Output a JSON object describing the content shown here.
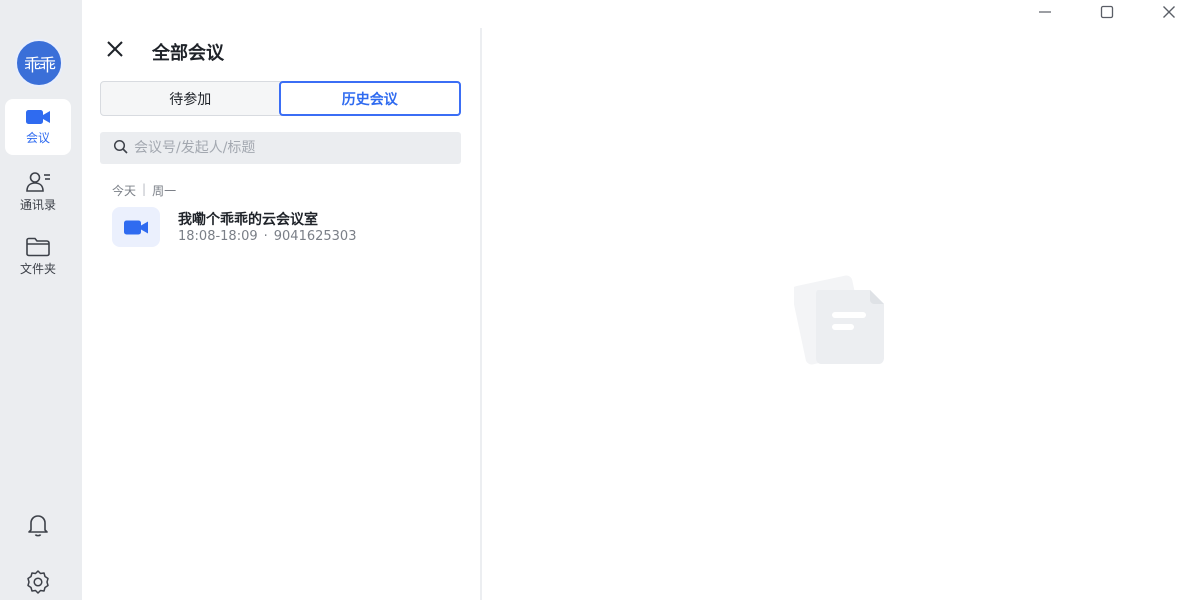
{
  "rail": {
    "avatar_text": "乖乖",
    "items": [
      {
        "label": "会议",
        "icon": "video-camera-icon",
        "active": true
      },
      {
        "label": "通讯录",
        "icon": "contacts-icon",
        "active": false
      },
      {
        "label": "文件夹",
        "icon": "folder-icon",
        "active": false
      }
    ],
    "bottom_icons": [
      "bell-icon",
      "gear-icon"
    ]
  },
  "panel": {
    "title": "全部会议",
    "tabs": [
      {
        "label": "待参加",
        "active": false
      },
      {
        "label": "历史会议",
        "active": true
      }
    ],
    "search": {
      "placeholder": "会议号/发起人/标题",
      "value": ""
    },
    "groups": [
      {
        "day": "今天",
        "weekday": "周一",
        "meetings": [
          {
            "title": "我嘞个乖乖的云会议室",
            "time": "18:08-18:09",
            "dot": "·",
            "meeting_id": "9041625303"
          }
        ]
      }
    ]
  },
  "window_controls": [
    "minimize-icon",
    "maximize-icon",
    "close-icon"
  ],
  "colors": {
    "accent": "#2f6bf0",
    "rail_bg": "#ebedf0",
    "avatar_bg": "#3a6fd8"
  }
}
